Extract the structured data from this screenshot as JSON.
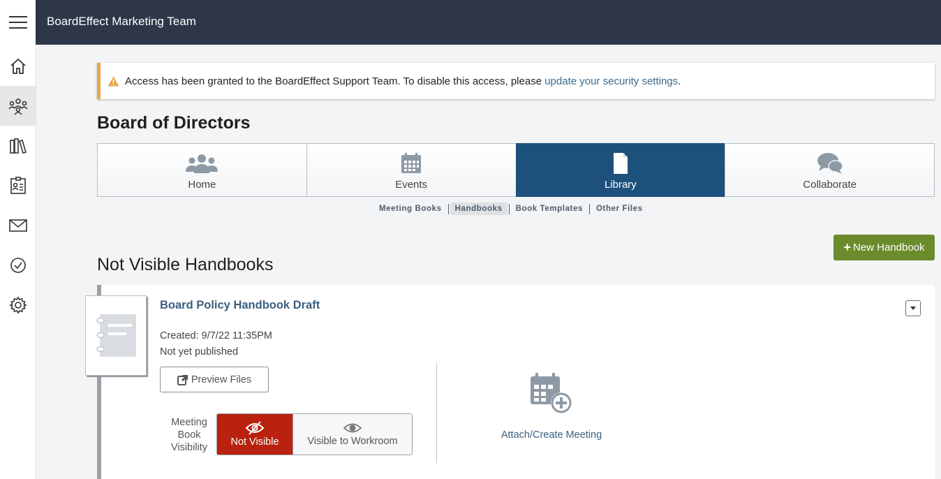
{
  "app": {
    "title": "BoardEffect Marketing Team"
  },
  "sidebar": {
    "items": [
      {
        "icon": "home-icon",
        "label": "Home"
      },
      {
        "icon": "people-network-icon",
        "label": "Workrooms"
      },
      {
        "icon": "library-books-icon",
        "label": "Libraries"
      },
      {
        "icon": "contact-card-icon",
        "label": "Directory"
      },
      {
        "icon": "envelope-icon",
        "label": "Messages"
      },
      {
        "icon": "check-circle-icon",
        "label": "Tasks"
      },
      {
        "icon": "gear-icon",
        "label": "Settings"
      }
    ],
    "active_index": 1
  },
  "alert": {
    "text": "Access has been granted to the BoardEffect Support Team. To disable this access, please ",
    "link": "update your security settings",
    "suffix": ".",
    "accent_color": "#e6a84c"
  },
  "page": {
    "title": "Board of Directors"
  },
  "tabs": [
    {
      "label": "Home",
      "icon": "people-icon"
    },
    {
      "label": "Events",
      "icon": "calendar-icon"
    },
    {
      "label": "Library",
      "icon": "document-icon"
    },
    {
      "label": "Collaborate",
      "icon": "chat-bubbles-icon"
    }
  ],
  "active_tab": "Library",
  "subnav": {
    "items": [
      "Meeting Books",
      "Handbooks",
      "Book Templates",
      "Other Files"
    ],
    "active": "Handbooks"
  },
  "actions": {
    "new_handbook": "New Handbook"
  },
  "section": {
    "title": "Not Visible Handbooks"
  },
  "handbook": {
    "title": "Board Policy Handbook Draft",
    "created": "Created: 9/7/22 11:35PM",
    "status": "Not yet published",
    "preview_label": "Preview Files",
    "visibility_label": "Meeting Book Visibility",
    "visibility_options": [
      "Not Visible",
      "Visible to Workroom"
    ],
    "visibility_selected": "Not Visible",
    "attach_label": "Attach/Create Meeting"
  },
  "colors": {
    "topbar": "#2d3748",
    "active_tab": "#1e507c",
    "new_button": "#6c8b2c",
    "not_visible": "#b8220e",
    "link": "#3a5f80"
  }
}
